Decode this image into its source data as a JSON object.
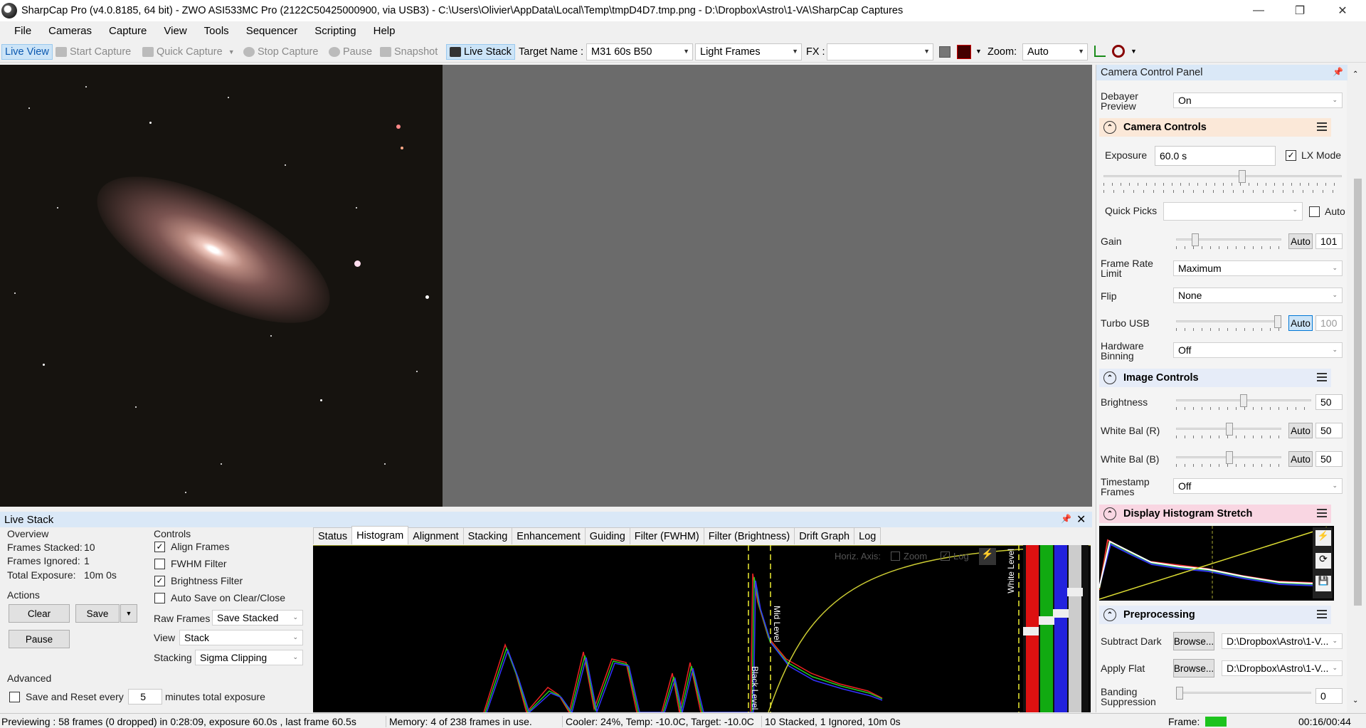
{
  "window": {
    "title": "SharpCap Pro (v4.0.8185, 64 bit) - ZWO ASI533MC Pro (2122C50425000900, via USB3) - C:\\Users\\Olivier\\AppData\\Local\\Temp\\tmpD4D7.tmp.png - D:\\Dropbox\\Astro\\1-VA\\SharpCap Captures"
  },
  "menu": [
    "File",
    "Cameras",
    "Capture",
    "View",
    "Tools",
    "Sequencer",
    "Scripting",
    "Help"
  ],
  "toolbar": {
    "live_view": "Live View",
    "start_capture": "Start Capture",
    "quick_capture": "Quick Capture",
    "stop_capture": "Stop Capture",
    "pause": "Pause",
    "snapshot": "Snapshot",
    "live_stack": "Live Stack",
    "target_name_label": "Target Name :",
    "target_name_value": "M31 60s B50",
    "frame_type": "Light Frames",
    "fx_label": "FX :",
    "fx_value": "",
    "zoom_label": "Zoom:",
    "zoom_value": "Auto"
  },
  "camera_panel": {
    "title": "Camera Control Panel",
    "debayer_label": "Debayer Preview",
    "debayer_value": "On",
    "camera_controls": {
      "header": "Camera Controls",
      "exposure_label": "Exposure",
      "exposure_value": "60.0 s",
      "lx_mode_label": "LX Mode",
      "lx_mode_checked": true,
      "quick_picks_label": "Quick Picks",
      "quick_picks_value": "",
      "auto_label": "Auto",
      "gain_label": "Gain",
      "gain_auto": "Auto",
      "gain_value": "101",
      "gain_level": 0.15,
      "frame_rate_label": "Frame Rate Limit",
      "frame_rate_value": "Maximum",
      "flip_label": "Flip",
      "flip_value": "None",
      "turbo_label": "Turbo USB",
      "turbo_auto": "Auto",
      "turbo_value": "100",
      "binning_label": "Hardware Binning",
      "binning_value": "Off"
    },
    "image_controls": {
      "header": "Image Controls",
      "brightness_label": "Brightness",
      "brightness_value": "50",
      "wb_r_label": "White Bal (R)",
      "wb_r_auto": "Auto",
      "wb_r_value": "50",
      "wb_b_label": "White Bal (B)",
      "wb_b_auto": "Auto",
      "wb_b_value": "50",
      "timestamp_label": "Timestamp Frames",
      "timestamp_value": "Off"
    },
    "histogram_stretch": {
      "header": "Display Histogram Stretch"
    },
    "preprocessing": {
      "header": "Preprocessing",
      "subtract_dark_label": "Subtract Dark",
      "browse_label": "Browse...",
      "dark_path": "D:\\Dropbox\\Astro\\1-V...",
      "apply_flat_label": "Apply Flat",
      "flat_path": "D:\\Dropbox\\Astro\\1-V...",
      "banding_label": "Banding Suppression",
      "banding_value": "0"
    }
  },
  "live_stack": {
    "title": "Live Stack",
    "overview_label": "Overview",
    "frames_stacked_label": "Frames Stacked:",
    "frames_stacked_value": "10",
    "frames_ignored_label": "Frames Ignored:",
    "frames_ignored_value": "1",
    "total_exposure_label": "Total Exposure:",
    "total_exposure_value": "10m 0s",
    "actions_label": "Actions",
    "clear": "Clear",
    "save": "Save",
    "pause": "Pause",
    "advanced_label": "Advanced",
    "save_reset_label": "Save and Reset every",
    "save_reset_value": "5",
    "minutes_label": "minutes total exposure",
    "controls_label": "Controls",
    "align_frames": "Align Frames",
    "fwhm_filter": "FWHM Filter",
    "brightness_filter": "Brightness Filter",
    "auto_save": "Auto Save on Clear/Close",
    "raw_frames_label": "Raw Frames",
    "raw_frames_value": "Save Stacked",
    "view_label": "View",
    "view_value": "Stack",
    "stacking_label": "Stacking",
    "stacking_value": "Sigma Clipping",
    "tabs": [
      "Status",
      "Histogram",
      "Alignment",
      "Stacking",
      "Enhancement",
      "Guiding",
      "Filter (FWHM)",
      "Filter (Brightness)",
      "Drift Graph",
      "Log"
    ],
    "active_tab": "Histogram",
    "histogram": {
      "horiz_axis": "Horiz. Axis:",
      "zoom": "Zoom",
      "log": "Log",
      "black_level": "Black Level",
      "mid_level": "Mid Level",
      "white_level": "White Level"
    }
  },
  "status": {
    "preview": "Previewing : 58 frames (0 dropped) in 0:28:09, exposure 60.0s , last frame 60.5s",
    "memory": "Memory: 4 of 238 frames in use.",
    "cooler": "Cooler: 24%, Temp: -10.0C, Target: -10.0C",
    "stacked": "10 Stacked, 1 Ignored, 10m 0s",
    "frame_label": "Frame:",
    "time": "00:16/00:44"
  }
}
